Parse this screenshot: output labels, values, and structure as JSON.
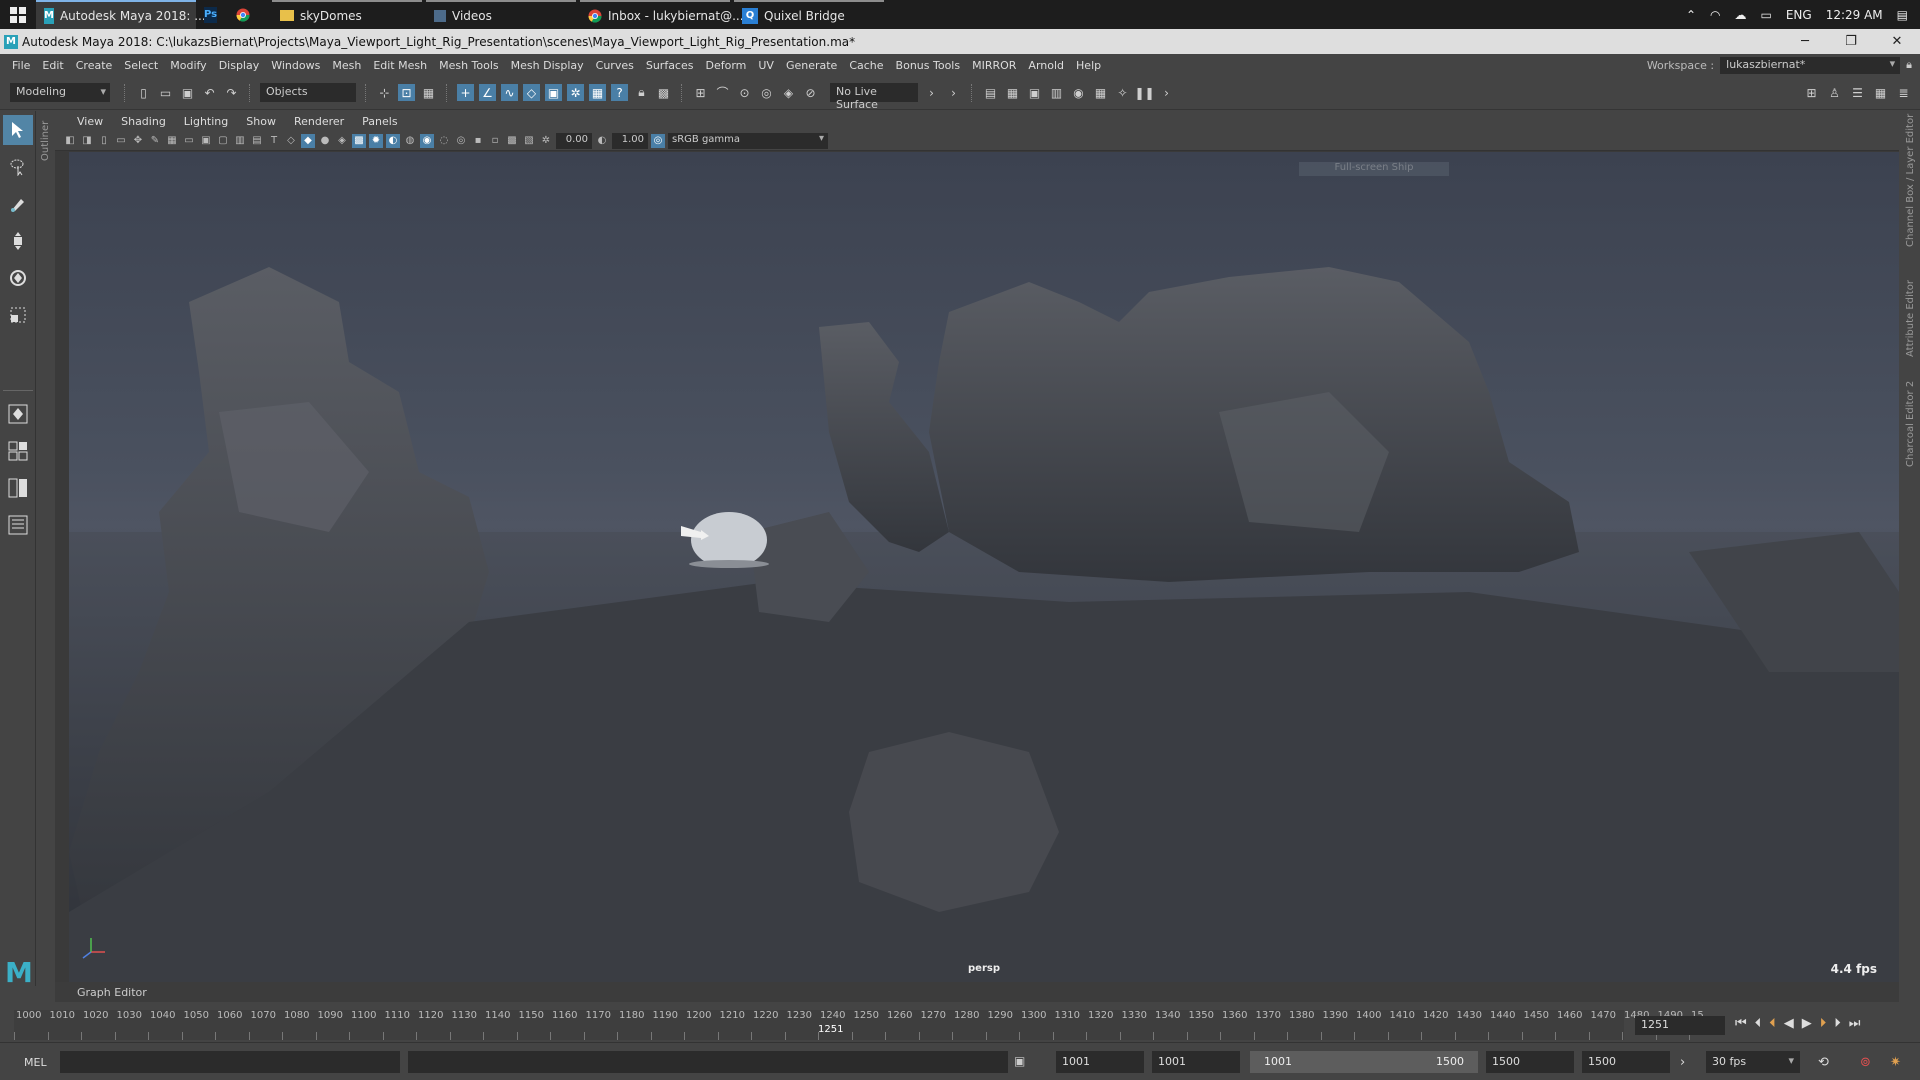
{
  "taskbar": {
    "items": [
      {
        "label": "Autodesk Maya 2018: ...",
        "icon": "maya-icon"
      },
      {
        "label": "",
        "icon": "photoshop-icon"
      },
      {
        "label": "",
        "icon": "chrome-icon"
      },
      {
        "label": "skyDomes",
        "icon": "folder-icon"
      },
      {
        "label": "Videos",
        "icon": "video-folder-icon"
      },
      {
        "label": "Inbox - lukybiernat@...",
        "icon": "chrome-icon"
      },
      {
        "label": "Quixel Bridge",
        "icon": "quixel-icon"
      }
    ],
    "tray": {
      "lang": "ENG",
      "time": "12:29 AM"
    }
  },
  "titlebar": {
    "title": "Autodesk Maya 2018: C:\\lukazsBiernat\\Projects\\Maya_Viewport_Light_Rig_Presentation\\scenes\\Maya_Viewport_Light_Rig_Presentation.ma*"
  },
  "menubar": {
    "items": [
      "File",
      "Edit",
      "Create",
      "Select",
      "Modify",
      "Display",
      "Windows",
      "Mesh",
      "Edit Mesh",
      "Mesh Tools",
      "Mesh Display",
      "Curves",
      "Surfaces",
      "Deform",
      "UV",
      "Generate",
      "Cache",
      "Bonus Tools",
      "MIRROR",
      "Arnold",
      "Help"
    ],
    "workspace_label": "Workspace :",
    "workspace_value": "lukaszbiernat*"
  },
  "statusline": {
    "menuset": "Modeling",
    "selection_mode": "Objects",
    "live_surface": "No Live Surface"
  },
  "outliner_tab": "Outliner",
  "panel": {
    "menus": [
      "View",
      "Shading",
      "Lighting",
      "Show",
      "Renderer",
      "Panels"
    ],
    "exposure": "0.00",
    "gamma": "1.00",
    "color_space": "sRGB gamma",
    "hud_ghost": "Full-screen Ship"
  },
  "viewport": {
    "camera": "persp",
    "fps": "4.4 fps"
  },
  "right_tabs": [
    "Channel Box / Layer Editor",
    "Attribute Editor",
    "Charcoal Editor 2"
  ],
  "graph_editor_tab": "Graph Editor",
  "timeslider": {
    "ticks": [
      "1000",
      "1010",
      "1020",
      "1030",
      "1040",
      "1050",
      "1060",
      "1070",
      "1080",
      "1090",
      "1100",
      "1110",
      "1120",
      "1130",
      "1140",
      "1150",
      "1160",
      "1170",
      "1180",
      "1190",
      "1200",
      "1210",
      "1220",
      "1230",
      "1240",
      "1250",
      "1260",
      "1270",
      "1280",
      "1290",
      "1300",
      "1310",
      "1320",
      "1330",
      "1340",
      "1350",
      "1360",
      "1370",
      "1380",
      "1390",
      "1400",
      "1410",
      "1420",
      "1430",
      "1440",
      "1450",
      "1460",
      "1470",
      "1480",
      "1490",
      "15"
    ],
    "current_marker": "1251",
    "current_frame": "1251"
  },
  "range": {
    "command_lang": "MEL",
    "start": "1001",
    "playback_start": "1001",
    "range_min": "1001",
    "range_max": "1500",
    "playback_end": "1500",
    "end": "1500",
    "fps": "30 fps"
  }
}
